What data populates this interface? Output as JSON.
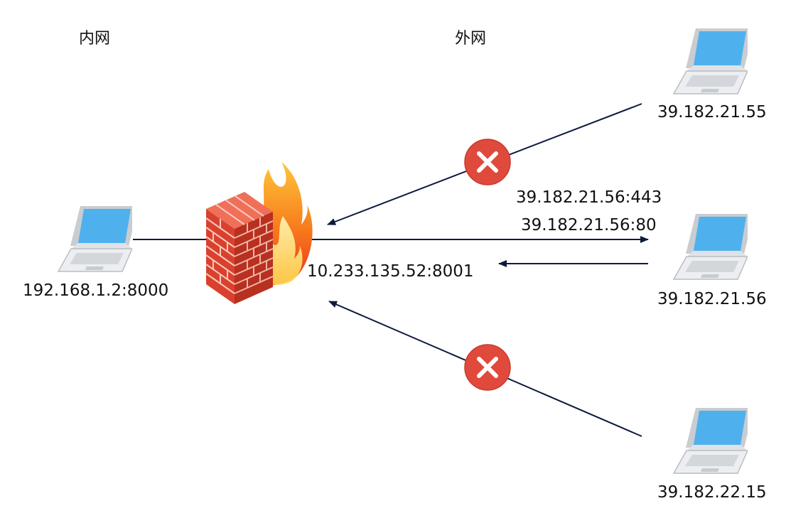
{
  "zones": {
    "inner": "内网",
    "outer": "外网"
  },
  "hosts": {
    "inner": "192.168.1.2:8000",
    "top": "39.182.21.55",
    "middle": "39.182.21.56",
    "bottom": "39.182.22.15"
  },
  "firewall_address": "10.233.135.52:8001",
  "allowed_ports": [
    "39.182.21.56:443",
    "39.182.21.56:80"
  ],
  "icons": {
    "laptop": "laptop-icon",
    "firewall": "firewall-icon",
    "blocked": "blocked-x-icon"
  },
  "colors": {
    "line": "#0e1a3d",
    "blocked": "#e04a3c",
    "screen": "#4fb0ee",
    "brick": "#d9412e"
  }
}
